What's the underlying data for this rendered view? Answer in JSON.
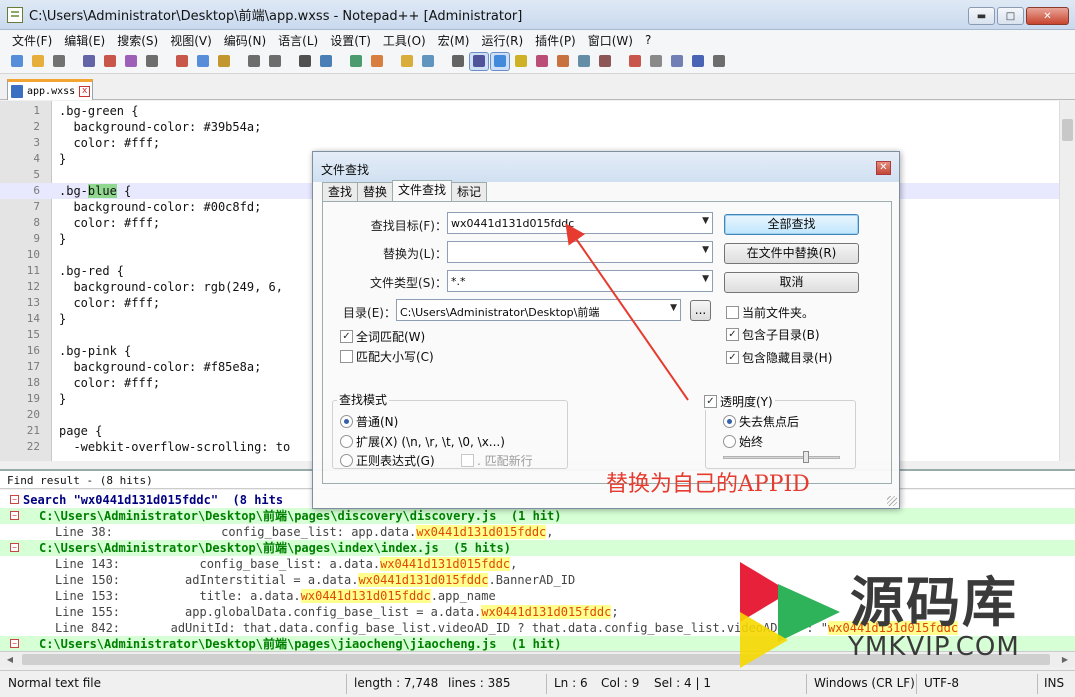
{
  "window": {
    "title": "C:\\Users\\Administrator\\Desktop\\前端\\app.wxss - Notepad++ [Administrator]",
    "minimize": "▬",
    "maximize": "□",
    "close": "✕"
  },
  "menu": [
    "文件(F)",
    "编辑(E)",
    "搜索(S)",
    "视图(V)",
    "编码(N)",
    "语言(L)",
    "设置(T)",
    "工具(O)",
    "宏(M)",
    "运行(R)",
    "插件(P)",
    "窗口(W)",
    "?"
  ],
  "toolbar": {
    "icons": [
      "new-file-icon",
      "open-file-icon",
      "save-icon",
      "save-all-icon",
      "close-icon",
      "close-all-icon",
      "print-icon",
      "cut-icon",
      "copy-icon",
      "paste-icon",
      "undo-icon",
      "redo-icon",
      "find-icon",
      "replace-icon",
      "zoom-in-icon",
      "zoom-out-icon",
      "sync-v-icon",
      "sync-h-icon",
      "wrap-icon",
      "all-chars-icon",
      "indent-guide-icon",
      "udl-icon",
      "doc-map-icon",
      "function-list-icon",
      "folder-workspace-icon",
      "monitor-icon",
      "record-macro-icon",
      "stop-record-icon",
      "play-macro-icon",
      "run-multiple-icon",
      "save-macro-icon"
    ]
  },
  "tab": {
    "label": "app.wxss",
    "close": "x"
  },
  "editor": {
    "lines": [
      {
        "n": "1",
        "t": ".bg-green {"
      },
      {
        "n": "2",
        "t": "  background-color: #39b54a;"
      },
      {
        "n": "3",
        "t": "  color: #fff;"
      },
      {
        "n": "4",
        "t": "}"
      },
      {
        "n": "5",
        "t": ""
      },
      {
        "n": "6",
        "pre": ".bg-",
        "hl": "blue",
        "post": " {"
      },
      {
        "n": "7",
        "t": "  background-color: #00c8fd;"
      },
      {
        "n": "8",
        "t": "  color: #fff;"
      },
      {
        "n": "9",
        "t": "}"
      },
      {
        "n": "10",
        "t": ""
      },
      {
        "n": "11",
        "t": ".bg-red {"
      },
      {
        "n": "12",
        "t": "  background-color: rgb(249, 6,"
      },
      {
        "n": "13",
        "t": "  color: #fff;"
      },
      {
        "n": "14",
        "t": "}"
      },
      {
        "n": "15",
        "t": ""
      },
      {
        "n": "16",
        "t": ".bg-pink {"
      },
      {
        "n": "17",
        "t": "  background-color: #f85e8a;"
      },
      {
        "n": "18",
        "t": "  color: #fff;"
      },
      {
        "n": "19",
        "t": "}"
      },
      {
        "n": "20",
        "t": ""
      },
      {
        "n": "21",
        "t": "page {"
      },
      {
        "n": "22",
        "t": "  -webkit-overflow-scrolling: to"
      }
    ]
  },
  "find_results": {
    "header": "Find result -  (8 hits)",
    "search_line": "Search \"wx0441d131d015fddc\"  (8 hits",
    "term": "wx0441d131d015fddc",
    "entries": [
      {
        "kind": "file",
        "text": "C:\\Users\\Administrator\\Desktop\\前端\\pages\\discovery\\discovery.js  (1 hit)"
      },
      {
        "kind": "hit",
        "pre": "Line 38:               config_base_list: app.data.",
        "post": ","
      },
      {
        "kind": "file",
        "text": "C:\\Users\\Administrator\\Desktop\\前端\\pages\\index\\index.js  (5 hits)"
      },
      {
        "kind": "hit",
        "pre": "Line 143:           config_base_list: a.data.",
        "post": ","
      },
      {
        "kind": "hit",
        "pre": "Line 150:         adInterstitial = a.data.",
        "post": ".BannerAD_ID"
      },
      {
        "kind": "hit",
        "pre": "Line 153:           title: a.data.",
        "post": ".app_name"
      },
      {
        "kind": "hit",
        "pre": "Line 155:         app.globalData.config_base_list = a.data.",
        "post": ";"
      },
      {
        "kind": "hit",
        "pre": "Line 842:       adUnitId: that.data.config_base_list.videoAD_ID ? that.data.config_base_list.videoAD_ID : \"",
        "post": ""
      },
      {
        "kind": "file",
        "text": "C:\\Users\\Administrator\\Desktop\\前端\\pages\\jiaocheng\\jiaocheng.js  (1 hit)"
      }
    ]
  },
  "status": {
    "filetype": "Normal text file",
    "length": "length : 7,748",
    "lines": "lines : 385",
    "ln": "Ln : 6",
    "col": "Col : 9",
    "sel": "Sel : 4 | 1",
    "eol": "Windows (CR LF)",
    "encoding": "UTF-8",
    "mode": "INS"
  },
  "dialog": {
    "title": "文件查找",
    "tabs": [
      "查找",
      "替换",
      "文件查找",
      "标记"
    ],
    "active_tab": "文件查找",
    "find_label": "查找目标(F)：",
    "find_value": "wx0441d131d015fddc",
    "replace_label": "替换为(L)：",
    "replace_value": "",
    "filter_label": "文件类型(S)：",
    "filter_value": "*.*",
    "dir_label": "目录(E)：",
    "dir_value": "C:\\Users\\Administrator\\Desktop\\前端",
    "browse": "...",
    "btn_find_all": "全部查找",
    "btn_replace_in_files": "在文件中替换(R)",
    "btn_cancel": "取消",
    "chk_current_folder": "当前文件夹。",
    "chk_subfolders": "包含子目录(B)",
    "chk_hidden": "包含隐藏目录(H)",
    "chk_whole_word": "全词匹配(W)",
    "chk_match_case": "匹配大小写(C)",
    "search_mode_title": "查找模式",
    "mode_normal": "普通(N)",
    "mode_extended": "扩展(X) (\\n, \\r, \\t, \\0, \\x...)",
    "mode_regex": "正则表达式(G)",
    "chk_dot_newline": ". 匹配新行",
    "chk_transparency": "透明度(Y)",
    "opt_on_lose_focus": "失去焦点后",
    "opt_always": "始终"
  },
  "annotation": "替换为自己的APPID",
  "watermark": {
    "title": "源码库",
    "subtitle": "YMKVIP.COM"
  },
  "colors": {
    "annotation_red": "#e63b2e",
    "hit_orange": "#e04a00",
    "file_line_bg": "#d6ffd6",
    "green_logo": "#2fb35a",
    "red_logo": "#e8213b",
    "yellow_logo": "#f6d800"
  }
}
